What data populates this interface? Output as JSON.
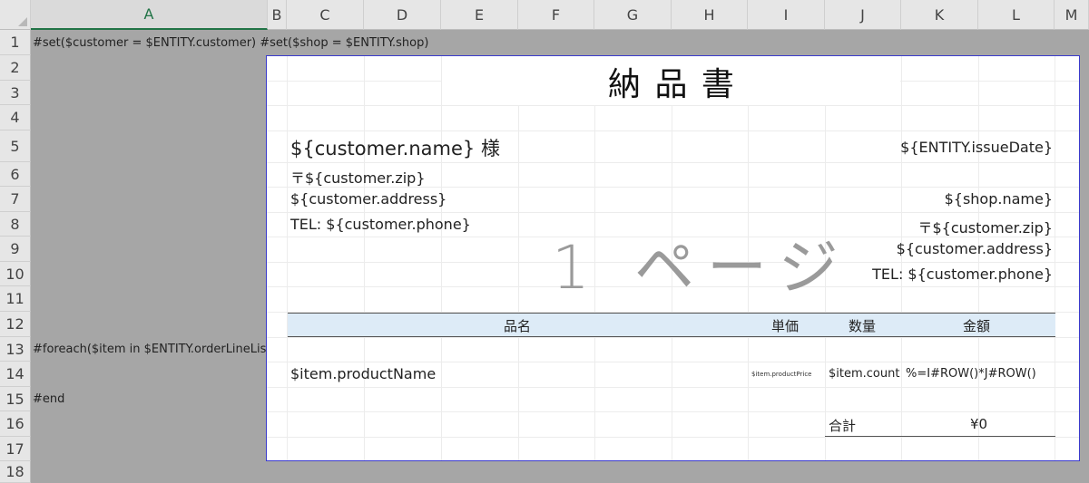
{
  "columns": [
    "A",
    "B",
    "C",
    "D",
    "E",
    "F",
    "G",
    "H",
    "I",
    "J",
    "K",
    "L",
    "M"
  ],
  "rows": [
    "1",
    "2",
    "3",
    "4",
    "5",
    "6",
    "7",
    "8",
    "9",
    "10",
    "11",
    "12",
    "13",
    "14",
    "15",
    "16",
    "17",
    "18"
  ],
  "col_a_cells": {
    "r1": "#set($customer = $ENTITY.customer) #set($shop = $ENTITY.shop)",
    "r13": "#foreach($item in $ENTITY.orderLineList)",
    "r15": "#end"
  },
  "document": {
    "title": "納 品 書",
    "customer_name": "${customer.name} 様",
    "customer_zip": "〒${customer.zip}",
    "customer_address": "${customer.address}",
    "customer_phone": "TEL: ${customer.phone}",
    "issue_date": "${ENTITY.issueDate}",
    "shop_name": "${shop.name}",
    "shop_zip": "〒${customer.zip}",
    "shop_address": "${customer.address}",
    "shop_phone": "TEL: ${customer.phone}",
    "watermark": "1 ページ"
  },
  "table": {
    "headers": {
      "product": "品名",
      "unit_price": "単価",
      "quantity": "数量",
      "amount": "金額"
    },
    "row": {
      "product": "$item.productName",
      "unit_price": "$item.productPrice",
      "quantity": "$item.count",
      "amount": "%=I#ROW()*J#ROW()"
    },
    "total_label": "合計",
    "total_value": "¥0"
  },
  "colors": {
    "header_band": "#ddebf7",
    "page_border": "#3a3acc",
    "selected_column": "#217346"
  }
}
